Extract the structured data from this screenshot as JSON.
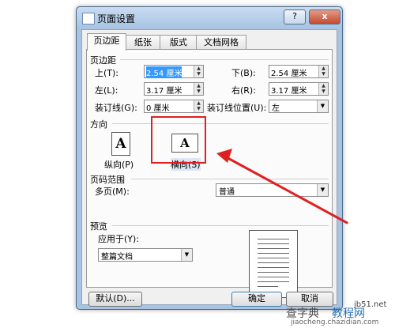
{
  "dialog": {
    "title": "页面设置",
    "help_label": "?",
    "close_label": "x"
  },
  "tabs": [
    {
      "label": "页边距",
      "active": true
    },
    {
      "label": "纸张",
      "active": false
    },
    {
      "label": "版式",
      "active": false
    },
    {
      "label": "文档网格",
      "active": false
    }
  ],
  "margins": {
    "section_title": "页边距",
    "top_label": "上(T):",
    "top_value": "2.54 厘米",
    "bottom_label": "下(B):",
    "bottom_value": "2.54 厘米",
    "left_label": "左(L):",
    "left_value": "3.17 厘米",
    "right_label": "右(R):",
    "right_value": "3.17 厘米",
    "gutter_label": "装订线(G):",
    "gutter_value": "0 厘米",
    "gutter_pos_label": "装订线位置(U):",
    "gutter_pos_value": "左"
  },
  "orientation": {
    "section_title": "方向",
    "portrait_label": "纵向(P)",
    "landscape_label": "横向(S)",
    "icon_letter": "A"
  },
  "pages": {
    "section_title": "页码范围",
    "multiple_label": "多页(M):",
    "multiple_value": "普通"
  },
  "preview": {
    "section_title": "预览",
    "apply_label": "应用于(Y):",
    "apply_value": "整篇文档"
  },
  "buttons": {
    "default_label": "默认(D)...",
    "ok_label": "确定",
    "cancel_label": "取消"
  },
  "watermark": {
    "site": "jb51.net",
    "line1": "查字典",
    "line2": "教程网",
    "url": "jiaocheng.chazidian.com"
  },
  "colors": {
    "annotation_red": "#e02020",
    "selection_blue": "#3399ff",
    "title_blue": "#a9c3e0"
  }
}
